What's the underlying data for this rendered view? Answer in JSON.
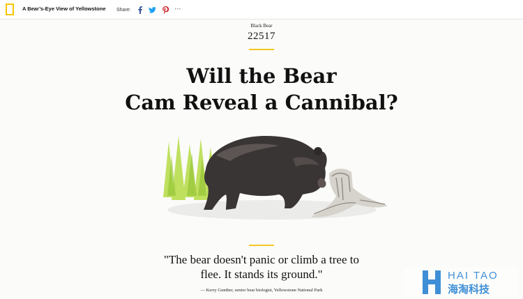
{
  "header": {
    "title": "A Bear’s-Eye View of Yellowstone",
    "share_label": "Share:",
    "share_icons": [
      "facebook-icon",
      "twitter-icon",
      "pinterest-icon",
      "more-icon"
    ],
    "more_glyph": "•••"
  },
  "article": {
    "eyebrow": "Black Bear",
    "number": "22517",
    "headline_line1": "Will the Bear",
    "headline_line2": "Cam Reveal a Cannibal?",
    "quote_line1": "\"The bear doesn't panic or climb a tree to",
    "quote_line2": "flee. It stands its ground.\"",
    "attribution": "— Kerry Gunther, senior bear biologist, Yellowstone National Park"
  },
  "watermark": {
    "latin": "HAI TAO",
    "chinese": "海淘科技"
  },
  "colors": {
    "accent": "#f3c623",
    "logo_yellow": "#f7c600",
    "facebook": "#3b5998",
    "twitter": "#1da1f2",
    "pinterest": "#cb2027",
    "watermark": "#3f8fd6"
  }
}
